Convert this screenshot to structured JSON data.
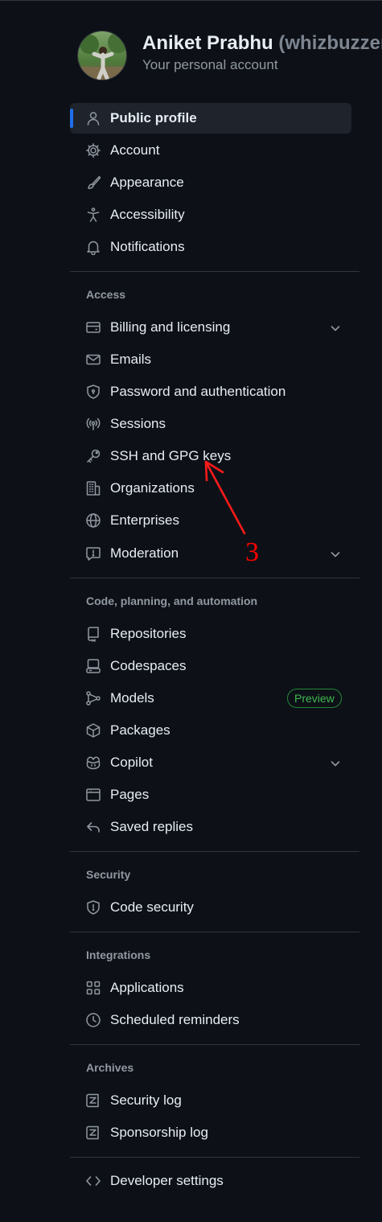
{
  "header": {
    "display_name": "Aniket Prabhu",
    "username": "(whizbuzzer)",
    "subtitle": "Your personal account"
  },
  "nav": {
    "top_items": [
      {
        "label": "Public profile",
        "icon": "person-icon",
        "active": true
      },
      {
        "label": "Account",
        "icon": "gear-icon"
      },
      {
        "label": "Appearance",
        "icon": "paintbrush-icon"
      },
      {
        "label": "Accessibility",
        "icon": "accessibility-icon"
      },
      {
        "label": "Notifications",
        "icon": "bell-icon"
      }
    ],
    "access": {
      "title": "Access",
      "items": [
        {
          "label": "Billing and licensing",
          "icon": "credit-card-icon",
          "expandable": true
        },
        {
          "label": "Emails",
          "icon": "mail-icon"
        },
        {
          "label": "Password and authentication",
          "icon": "shield-lock-icon"
        },
        {
          "label": "Sessions",
          "icon": "broadcast-icon"
        },
        {
          "label": "SSH and GPG keys",
          "icon": "key-icon"
        },
        {
          "label": "Organizations",
          "icon": "organization-icon"
        },
        {
          "label": "Enterprises",
          "icon": "globe-icon"
        },
        {
          "label": "Moderation",
          "icon": "report-icon",
          "expandable": true
        }
      ]
    },
    "code": {
      "title": "Code, planning, and automation",
      "items": [
        {
          "label": "Repositories",
          "icon": "repo-icon"
        },
        {
          "label": "Codespaces",
          "icon": "codespaces-icon"
        },
        {
          "label": "Models",
          "icon": "models-icon",
          "badge": "Preview"
        },
        {
          "label": "Packages",
          "icon": "package-icon"
        },
        {
          "label": "Copilot",
          "icon": "copilot-icon",
          "expandable": true
        },
        {
          "label": "Pages",
          "icon": "browser-icon"
        },
        {
          "label": "Saved replies",
          "icon": "reply-icon"
        }
      ]
    },
    "security": {
      "title": "Security",
      "items": [
        {
          "label": "Code security",
          "icon": "shield-icon"
        }
      ]
    },
    "integrations": {
      "title": "Integrations",
      "items": [
        {
          "label": "Applications",
          "icon": "apps-icon"
        },
        {
          "label": "Scheduled reminders",
          "icon": "clock-icon"
        }
      ]
    },
    "archives": {
      "title": "Archives",
      "items": [
        {
          "label": "Security log",
          "icon": "log-icon"
        },
        {
          "label": "Sponsorship log",
          "icon": "log-icon"
        }
      ]
    },
    "developer": {
      "items": [
        {
          "label": "Developer settings",
          "icon": "code-icon"
        }
      ]
    }
  },
  "annotation": {
    "label": "3",
    "color": "#ff0000"
  },
  "colors": {
    "background": "#0d1117",
    "active_bar": "#1f6feb",
    "badge": "#3fb950"
  }
}
